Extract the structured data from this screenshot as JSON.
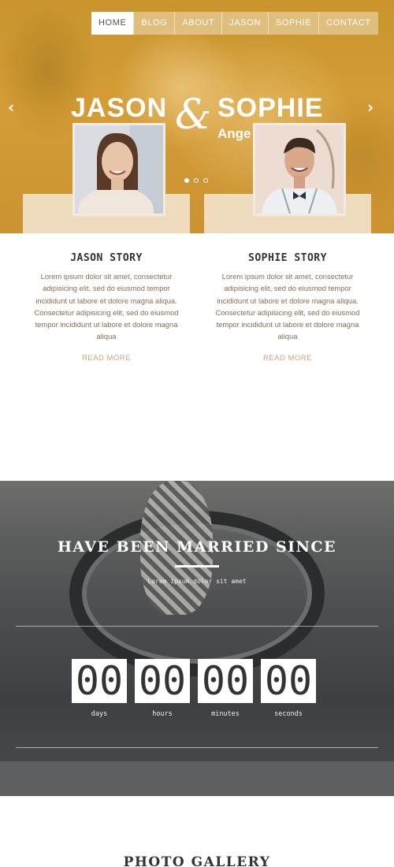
{
  "nav": {
    "items": [
      "HOME",
      "BLOG",
      "ABOUT",
      "JASON",
      "SOPHIE",
      "CONTACT"
    ],
    "active": "HOME"
  },
  "hero": {
    "name_left": "JASON",
    "ampersand": "&",
    "name_right": "SOPHIE",
    "sub_name": "Ange",
    "arrow_left": "‹",
    "arrow_right": "›",
    "slide_count": 3,
    "active_slide": 1
  },
  "stories": [
    {
      "title": "JASON STORY",
      "text": "Lorem ipsum dolor sit amet, consectetur adipisicing elit, sed do eiusmod tempor incididunt ut labore et dolore magna aliqua. Consectetur adipisicing elit, sed do eiusmod tempor incididunt ut labore et dolore magna aliqua",
      "link": "READ MORE"
    },
    {
      "title": "SOPHIE STORY",
      "text": "Lorem ipsum dolor sit amet, consectetur adipisicing elit, sed do eiusmod tempor incididunt ut labore et dolore magna aliqua. Consectetur adipisicing elit, sed do eiusmod tempor incididunt ut labore et dolore magna aliqua",
      "link": "READ MORE"
    }
  ],
  "countdown": {
    "title": "HAVE BEEN MARRIED SINCE",
    "subtitle": "Lorem ipsum dolor sit amet",
    "units": [
      {
        "value": "00",
        "label": "days"
      },
      {
        "value": "00",
        "label": "hours"
      },
      {
        "value": "00",
        "label": "minutes"
      },
      {
        "value": "00",
        "label": "seconds"
      }
    ]
  },
  "gallery": {
    "title": "PHOTO GALLERY"
  },
  "colors": {
    "accent": "#c9a27b",
    "hero_gold": "#d49c34"
  }
}
